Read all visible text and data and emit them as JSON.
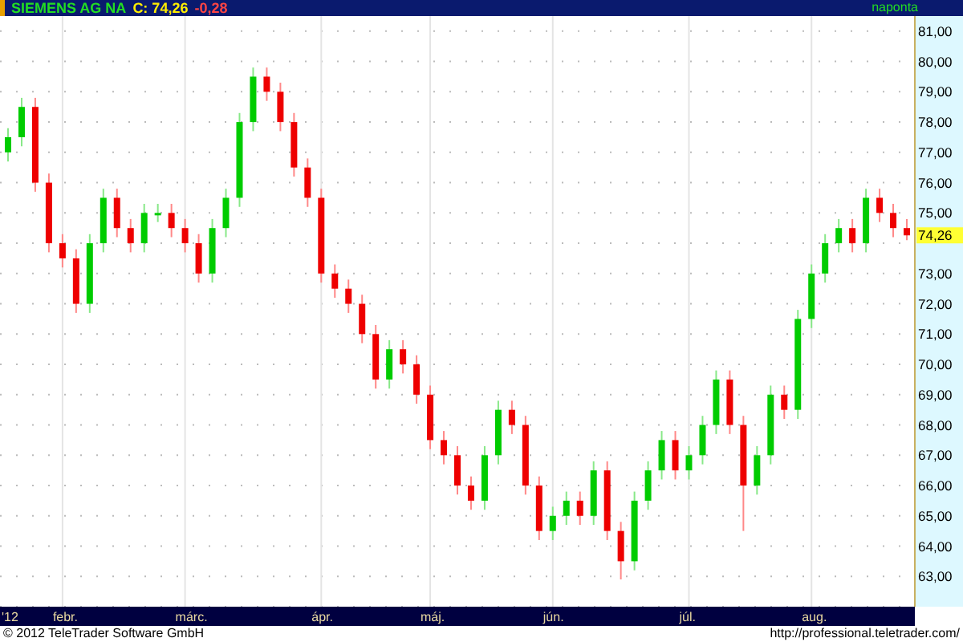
{
  "header": {
    "symbol": "SIEMENS AG NA",
    "close": "C: 74,26",
    "change": "-0,28",
    "interval": "naponta"
  },
  "chart": {
    "last_price": "74,26",
    "chart_data": {
      "type": "candlestick",
      "ylim": [
        62,
        81.5
      ],
      "grid": true,
      "yticks": [
        {
          "value": 63,
          "label": "63,00"
        },
        {
          "value": 64,
          "label": "64,00"
        },
        {
          "value": 65,
          "label": "65,00"
        },
        {
          "value": 66,
          "label": "66,00"
        },
        {
          "value": 67,
          "label": "67,00"
        },
        {
          "value": 68,
          "label": "68,00"
        },
        {
          "value": 69,
          "label": "69,00"
        },
        {
          "value": 70,
          "label": "70,00"
        },
        {
          "value": 71,
          "label": "71,00"
        },
        {
          "value": 72,
          "label": "72,00"
        },
        {
          "value": 73,
          "label": "73,00"
        },
        {
          "value": 75,
          "label": "75,00"
        },
        {
          "value": 76,
          "label": "76,00"
        },
        {
          "value": 77,
          "label": "77,00"
        },
        {
          "value": 78,
          "label": "78,00"
        },
        {
          "value": 79,
          "label": "79,00"
        },
        {
          "value": 80,
          "label": "80,00"
        },
        {
          "value": 81,
          "label": "81,00"
        }
      ],
      "categories": [
        "'12",
        null,
        null,
        null,
        "febr.",
        null,
        null,
        null,
        null,
        null,
        null,
        null,
        null,
        "márc.",
        null,
        null,
        null,
        null,
        null,
        null,
        null,
        null,
        null,
        "ápr.",
        null,
        null,
        null,
        null,
        null,
        null,
        null,
        "máj.",
        null,
        null,
        null,
        null,
        null,
        null,
        null,
        null,
        "jún.",
        null,
        null,
        null,
        null,
        null,
        null,
        null,
        null,
        null,
        "júl.",
        null,
        null,
        null,
        null,
        null,
        null,
        null,
        null,
        "aug.",
        null,
        null,
        null,
        null,
        null,
        null,
        null
      ],
      "ohlc": [
        [
          77,
          77.8,
          76.7,
          77.5
        ],
        [
          77.5,
          78.8,
          77.2,
          78.5
        ],
        [
          78.5,
          78.8,
          75.7,
          76
        ],
        [
          76,
          76.3,
          73.7,
          74
        ],
        [
          74,
          74.3,
          73.2,
          73.5
        ],
        [
          73.5,
          73.8,
          71.7,
          72
        ],
        [
          72,
          74.3,
          71.7,
          74
        ],
        [
          74,
          75.8,
          73.7,
          75.5
        ],
        [
          75.5,
          75.8,
          74.2,
          74.5
        ],
        [
          74.5,
          74.8,
          73.7,
          74
        ],
        [
          74,
          75.3,
          73.7,
          75
        ],
        [
          75,
          75.3,
          74.7,
          75
        ],
        [
          75,
          75.3,
          74.2,
          74.5
        ],
        [
          74.5,
          74.8,
          73.7,
          74
        ],
        [
          74,
          74.3,
          72.7,
          73
        ],
        [
          73,
          74.8,
          72.7,
          74.5
        ],
        [
          74.5,
          75.8,
          74.2,
          75.5
        ],
        [
          75.5,
          78.3,
          75.2,
          78
        ],
        [
          78,
          79.8,
          77.7,
          79.5
        ],
        [
          79.5,
          79.8,
          78.7,
          79
        ],
        [
          79,
          79.3,
          77.7,
          78
        ],
        [
          78,
          78.3,
          76.2,
          76.5
        ],
        [
          76.5,
          76.8,
          75.2,
          75.5
        ],
        [
          75.5,
          75.8,
          72.7,
          73
        ],
        [
          73,
          73.3,
          72.2,
          72.5
        ],
        [
          72.5,
          72.8,
          71.7,
          72
        ],
        [
          72,
          72.3,
          70.7,
          71
        ],
        [
          71,
          71.3,
          69.2,
          69.5
        ],
        [
          69.5,
          70.8,
          69.2,
          70.5
        ],
        [
          70.5,
          70.8,
          69.7,
          70
        ],
        [
          70,
          70.3,
          68.7,
          69
        ],
        [
          69,
          69.3,
          67.2,
          67.5
        ],
        [
          67.5,
          67.8,
          66.7,
          67
        ],
        [
          67,
          67.3,
          65.7,
          66
        ],
        [
          66,
          66.3,
          65.2,
          65.5
        ],
        [
          65.5,
          67.3,
          65.2,
          67
        ],
        [
          67,
          68.8,
          66.7,
          68.5
        ],
        [
          68.5,
          68.8,
          67.7,
          68
        ],
        [
          68,
          68.3,
          65.7,
          66
        ],
        [
          66,
          66.3,
          64.2,
          64.5
        ],
        [
          64.5,
          65.3,
          64.2,
          65
        ],
        [
          65,
          65.8,
          64.7,
          65.5
        ],
        [
          65.5,
          65.8,
          64.7,
          65
        ],
        [
          65,
          66.8,
          64.7,
          66.5
        ],
        [
          66.5,
          66.8,
          64.2,
          64.5
        ],
        [
          64.5,
          64.8,
          62.9,
          63.5
        ],
        [
          63.5,
          65.8,
          63.2,
          65.5
        ],
        [
          65.5,
          66.8,
          65.2,
          66.5
        ],
        [
          66.5,
          67.8,
          66.2,
          67.5
        ],
        [
          67.5,
          67.8,
          66.2,
          66.5
        ],
        [
          66.5,
          67.3,
          66.2,
          67
        ],
        [
          67,
          68.3,
          66.7,
          68
        ],
        [
          68,
          69.8,
          67.7,
          69.5
        ],
        [
          69.5,
          69.8,
          67.7,
          68
        ],
        [
          68,
          68.3,
          64.5,
          66
        ],
        [
          66,
          67.3,
          65.7,
          67
        ],
        [
          67,
          69.3,
          66.7,
          69
        ],
        [
          69,
          69.3,
          68.2,
          68.5
        ],
        [
          68.5,
          71.8,
          68.2,
          71.5
        ],
        [
          71.5,
          73.3,
          71.2,
          73
        ],
        [
          73,
          74.3,
          72.7,
          74
        ],
        [
          74,
          74.8,
          73.7,
          74.5
        ],
        [
          74.5,
          74.8,
          73.7,
          74
        ],
        [
          74,
          75.8,
          73.7,
          75.5
        ],
        [
          75.5,
          75.8,
          74.7,
          75
        ],
        [
          75,
          75.3,
          74.2,
          74.5
        ],
        [
          74.5,
          74.8,
          74.1,
          74.26
        ]
      ]
    }
  },
  "footer": {
    "copyright": "© 2012 TeleTrader Software GmbH",
    "url": "http://professional.teletrader.com/"
  }
}
